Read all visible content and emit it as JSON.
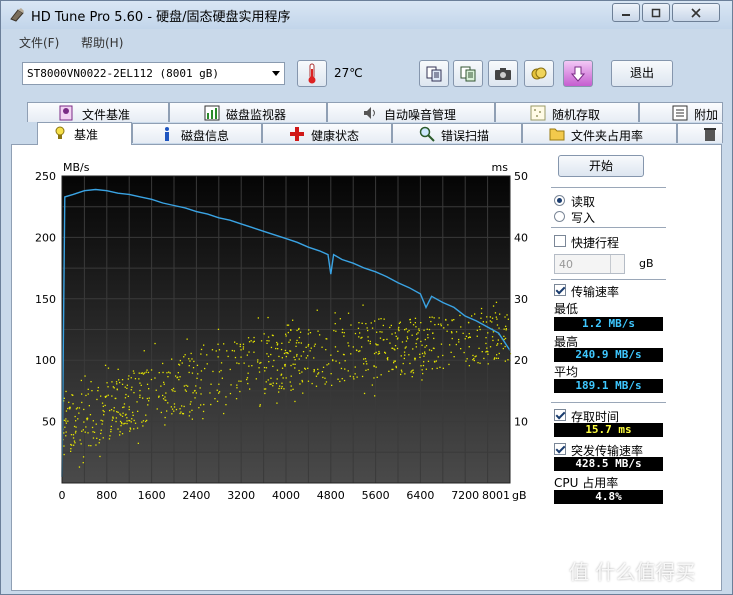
{
  "window": {
    "title": "HD Tune Pro 5.60 - 硬盘/固态硬盘实用程序"
  },
  "menu": [
    {
      "label": "文件(F)"
    },
    {
      "label": "帮助(H)"
    }
  ],
  "toolbar": {
    "drive": "ST8000VN0022-2EL112 (8001 gB)",
    "temperature": "27℃",
    "exit_label": "退出",
    "icons": [
      "thermometer-icon",
      "copy-info-icon",
      "copy-text-icon",
      "camera-icon",
      "save-icon",
      "download-icon"
    ]
  },
  "tabs_row1": [
    {
      "label": "文件基准",
      "icon": "file-benchmark-icon"
    },
    {
      "label": "磁盘监视器",
      "icon": "monitor-icon"
    },
    {
      "label": "自动噪音管理",
      "icon": "speaker-icon"
    },
    {
      "label": "随机存取",
      "icon": "random-access-icon"
    },
    {
      "label": "附加",
      "icon": "extra-icon"
    }
  ],
  "tabs_row2": [
    {
      "label": "基准",
      "icon": "benchmark-icon",
      "active": true
    },
    {
      "label": "磁盘信息",
      "icon": "info-icon"
    },
    {
      "label": "健康状态",
      "icon": "health-icon"
    },
    {
      "label": "错误扫描",
      "icon": "search-icon"
    },
    {
      "label": "文件夹占用率",
      "icon": "folder-icon"
    },
    {
      "label": "",
      "icon": "trash-icon"
    }
  ],
  "controls": {
    "start_label": "开始",
    "read_label": "读取",
    "write_label": "写入",
    "mode": "read",
    "short_stroke_label": "快捷行程",
    "short_stroke_checked": false,
    "short_stroke_value": "40",
    "short_stroke_unit": "gB",
    "transfer_rate_label": "传输速率",
    "transfer_rate_checked": true,
    "min_label": "最低",
    "min_value": "1.2 MB/s",
    "max_label": "最高",
    "max_value": "240.9 MB/s",
    "avg_label": "平均",
    "avg_value": "189.1 MB/s",
    "access_time_label": "存取时间",
    "access_time_checked": true,
    "access_time_value": "15.7 ms",
    "burst_rate_label": "突发传输速率",
    "burst_rate_checked": true,
    "burst_rate_value": "428.5 MB/s",
    "cpu_label": "CPU 占用率",
    "cpu_value": "4.8%"
  },
  "colors": {
    "transfer_line": "#3aa3e3",
    "access_points": "#e6e600",
    "value_cyan": "#3fc8ff",
    "value_yellow": "#ffff40",
    "value_white": "#ffffff"
  },
  "chart_data": {
    "type": "line",
    "ylabel_left": "MB/s",
    "ylabel_right": "ms",
    "x_unit": "gB",
    "xlim": [
      0,
      8001
    ],
    "ylim_left": [
      0,
      250
    ],
    "ylim_right": [
      0,
      50
    ],
    "x_ticks": [
      "0",
      "800",
      "1600",
      "2400",
      "3200",
      "4000",
      "4800",
      "5600",
      "6400",
      "7200",
      "8001"
    ],
    "y_ticks_left": [
      "250",
      "200",
      "150",
      "100",
      "50"
    ],
    "y_ticks_right": [
      "50",
      "40",
      "30",
      "20",
      "10"
    ],
    "grid": true,
    "series": [
      {
        "name": "传输速率",
        "axis": "left",
        "x": [
          0,
          50,
          200,
          400,
          600,
          800,
          1000,
          1200,
          1400,
          1600,
          1800,
          2000,
          2200,
          2400,
          2600,
          2800,
          3000,
          3200,
          3400,
          3600,
          3800,
          4000,
          4200,
          4400,
          4600,
          4750,
          4800,
          4850,
          5000,
          5200,
          5400,
          5600,
          5800,
          6000,
          6200,
          6400,
          6500,
          6600,
          6800,
          7000,
          7200,
          7400,
          7600,
          7800,
          8001
        ],
        "y": [
          5,
          233,
          235,
          238,
          239,
          238,
          236,
          235,
          233,
          231,
          228,
          226,
          224,
          221,
          219,
          216,
          214,
          211,
          208,
          205,
          202,
          199,
          196,
          192,
          189,
          186,
          170,
          186,
          182,
          179,
          175,
          172,
          168,
          163,
          159,
          154,
          143,
          152,
          147,
          143,
          136,
          132,
          127,
          122,
          108
        ]
      },
      {
        "name": "存取时间",
        "axis": "right",
        "type": "scatter",
        "range_lower": [
          {
            "x": 0,
            "y": 4
          },
          {
            "x": 800,
            "y": 7
          },
          {
            "x": 1600,
            "y": 10
          },
          {
            "x": 2400,
            "y": 12
          },
          {
            "x": 3200,
            "y": 14
          },
          {
            "x": 4000,
            "y": 15
          },
          {
            "x": 4800,
            "y": 16
          },
          {
            "x": 5600,
            "y": 17
          },
          {
            "x": 6400,
            "y": 18
          },
          {
            "x": 7200,
            "y": 19
          },
          {
            "x": 8001,
            "y": 20
          }
        ],
        "range_upper": [
          {
            "x": 0,
            "y": 14
          },
          {
            "x": 800,
            "y": 17
          },
          {
            "x": 1600,
            "y": 20
          },
          {
            "x": 2400,
            "y": 22
          },
          {
            "x": 3200,
            "y": 24
          },
          {
            "x": 4000,
            "y": 25
          },
          {
            "x": 4800,
            "y": 26
          },
          {
            "x": 5600,
            "y": 27
          },
          {
            "x": 6400,
            "y": 27
          },
          {
            "x": 7200,
            "y": 28
          },
          {
            "x": 8001,
            "y": 28
          }
        ]
      }
    ]
  },
  "watermark": "值 什么值得买"
}
